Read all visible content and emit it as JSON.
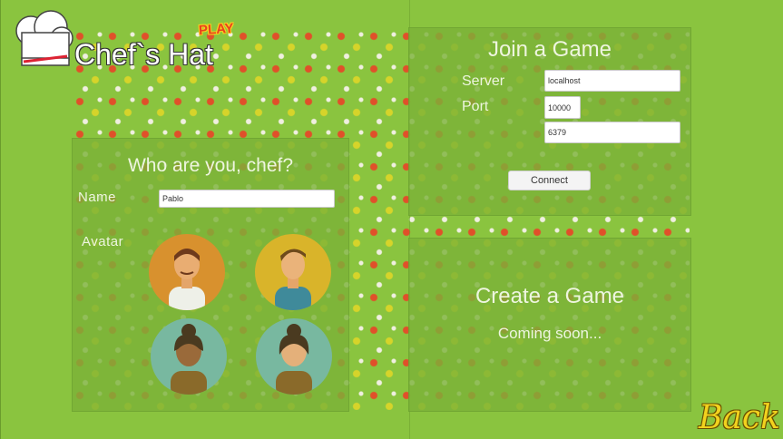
{
  "app": {
    "title": "Chef`s Hat",
    "badge": "PLAY"
  },
  "identity": {
    "title": "Who are you, chef?",
    "name_label": "Name",
    "name_value": "Pablo",
    "avatar_label": "Avatar",
    "avatars": [
      {
        "name": "chef-avatar-1",
        "bg": "#d8912e"
      },
      {
        "name": "chef-avatar-2",
        "bg": "#d9b42a"
      },
      {
        "name": "chef-avatar-3",
        "bg": "#78b8a0"
      },
      {
        "name": "chef-avatar-4",
        "bg": "#78b8a0"
      }
    ]
  },
  "join": {
    "title": "Join a Game",
    "server_label": "Server",
    "server_value": "localhost",
    "port_label": "Port",
    "port_value": "10000",
    "port2_value": "6379",
    "connect_label": "Connect"
  },
  "create": {
    "title": "Create a Game",
    "status": "Coming soon..."
  },
  "back_label": "Back",
  "colors": {
    "background": "#8ac43f",
    "panel": "#7ab238",
    "text": "#eef5df",
    "back": "#f2d21e"
  }
}
